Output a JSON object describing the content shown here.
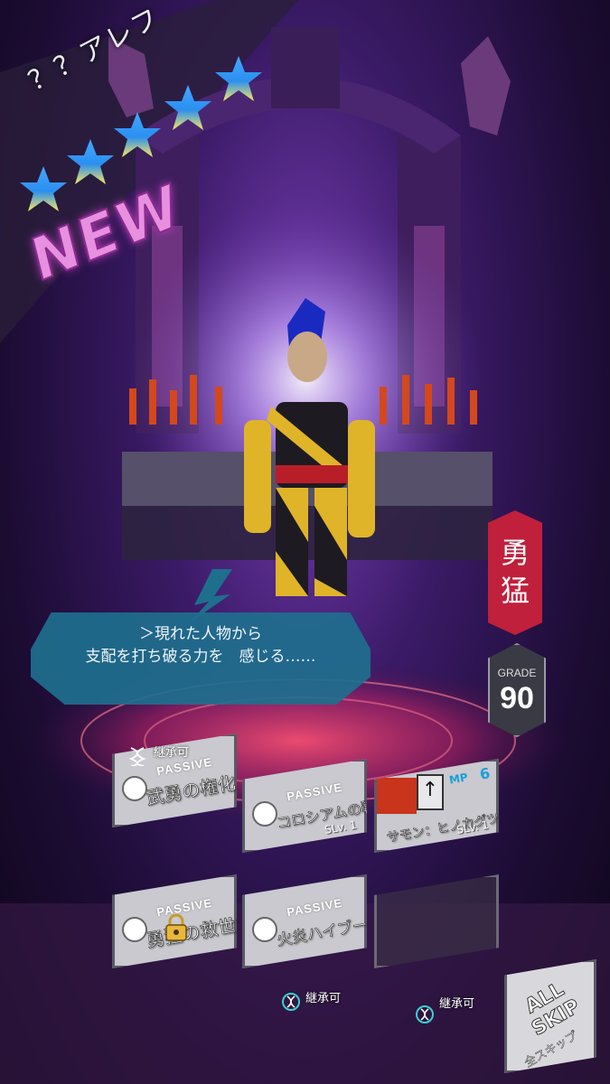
{
  "header": {
    "character_name": "？？アレフ",
    "star_count": 5,
    "new_label": "NEW"
  },
  "trait": {
    "label_line1": "勇",
    "label_line2": "猛"
  },
  "grade": {
    "label": "GRADE",
    "value": "90"
  },
  "speech": {
    "line1": "＞現れた人物から",
    "line2": "支配を打ち破る力を　感じる……"
  },
  "skills": [
    {
      "inherit": "継承可",
      "type": "PASSIVE",
      "name": "武勇の権化"
    },
    {
      "type": "PASSIVE",
      "name": "コロシアムの戦士",
      "level": "SLv. 1"
    },
    {
      "mp_label": "MP",
      "mp_value": "6",
      "name": "サモン：ヒノカグツチ",
      "level": "SLv. 1"
    },
    {
      "type": "PASSIVE",
      "name": "勇猛の救世主",
      "locked": true
    },
    {
      "type": "PASSIVE",
      "name": "火炎ハイブースタ",
      "inherit": "継承可"
    },
    {
      "inherit": "継承可",
      "empty": true
    }
  ],
  "all_skip": {
    "label_en": "ALL SKIP",
    "label_jp": "全スキップ"
  },
  "colors": {
    "trait_red": "#c0203c",
    "speech_blue": "#1e6f8e",
    "star_blue": "#2a8ff0",
    "star_yellow": "#f8e860",
    "new_pink": "#e890e0"
  }
}
